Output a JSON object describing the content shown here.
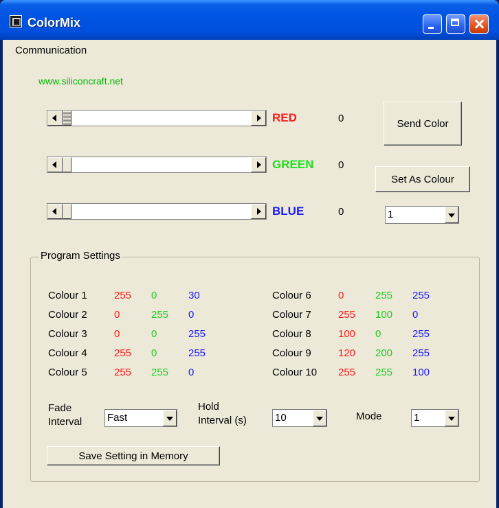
{
  "window": {
    "title": "ColorMix",
    "icon": "app-icon"
  },
  "menu": {
    "items": [
      "Communication"
    ]
  },
  "link": "www.siliconcraft.net",
  "channels": [
    {
      "label": "RED",
      "value": "0",
      "color": "#ff1a1a"
    },
    {
      "label": "GREEN",
      "value": "0",
      "color": "#22dd22"
    },
    {
      "label": "BLUE",
      "value": "0",
      "color": "#1a1aff"
    }
  ],
  "buttons": {
    "send": "Send Color",
    "set_as": "Set As Colour",
    "save": "Save Setting in Memory"
  },
  "colour_select": "1",
  "program": {
    "title": "Program Settings",
    "colours": [
      {
        "name": "Colour 1",
        "r": "255",
        "g": "0",
        "b": "30"
      },
      {
        "name": "Colour 2",
        "r": "0",
        "g": "255",
        "b": "0"
      },
      {
        "name": "Colour 3",
        "r": "0",
        "g": "0",
        "b": "255"
      },
      {
        "name": "Colour 4",
        "r": "255",
        "g": "0",
        "b": "255"
      },
      {
        "name": "Colour 5",
        "r": "255",
        "g": "255",
        "b": "0"
      },
      {
        "name": "Colour 6",
        "r": "0",
        "g": "255",
        "b": "255"
      },
      {
        "name": "Colour 7",
        "r": "255",
        "g": "100",
        "b": "0"
      },
      {
        "name": "Colour 8",
        "r": "100",
        "g": "0",
        "b": "255"
      },
      {
        "name": "Colour 9",
        "r": "120",
        "g": "200",
        "b": "255"
      },
      {
        "name": "Colour 10",
        "r": "255",
        "g": "255",
        "b": "100"
      }
    ],
    "fade": {
      "label1": "Fade",
      "label2": "Interval",
      "value": "Fast"
    },
    "hold": {
      "label1": "Hold",
      "label2": "Interval (s)",
      "value": "10"
    },
    "mode": {
      "label": "Mode",
      "value": "1"
    }
  }
}
